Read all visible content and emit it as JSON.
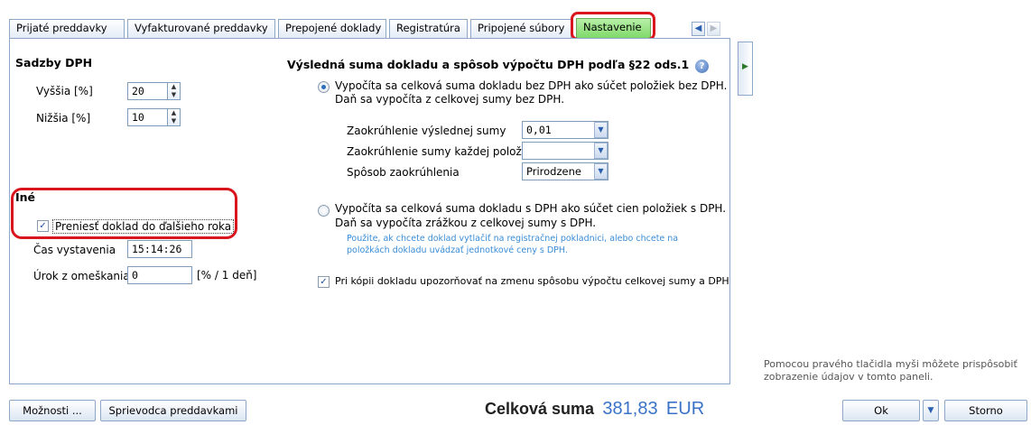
{
  "tabs": [
    {
      "label": "Prijaté preddavky"
    },
    {
      "label": "Vyfakturované preddavky"
    },
    {
      "label": "Prepojené doklady"
    },
    {
      "label": "Registratúra"
    },
    {
      "label": "Pripojené súbory"
    },
    {
      "label": "Nastavenie",
      "active": true
    }
  ],
  "vat_rates": {
    "title": "Sadzby DPH",
    "higher_label": "Vyššia [%]",
    "higher_value": "20",
    "lower_label": "Nižšia [%]",
    "lower_value": "10"
  },
  "calc": {
    "title": "Výsledná suma dokladu a spôsob výpočtu DPH podľa §22 ods.1",
    "option1_line1": "Vypočíta sa celková suma dokladu bez DPH ako súčet položiek bez DPH.",
    "option1_line2": "Daň sa vypočíta z celkovej sumy bez DPH.",
    "round_total_label": "Zaokrúhlenie výslednej sumy",
    "round_total_value": "0,01",
    "round_item_label": "Zaokrúhlenie sumy každej položky",
    "round_item_value": "",
    "round_method_label": "Spôsob zaokrúhlenia",
    "round_method_value": "Prirodzene",
    "option2_line1": "Vypočíta sa celková suma dokladu s DPH ako súčet cien položiek s DPH.",
    "option2_line2": "Daň sa vypočíta zrážkou z celkovej sumy s DPH.",
    "note_line1": "Použite, ak chcete doklad vytlačiť na registračnej pokladnici, alebo chcete na",
    "note_line2": "položkách dokladu uvádzať jednotkové ceny s DPH.",
    "warn_label": "Pri kópii dokladu upozorňovať na zmenu spôsobu výpočtu celkovej sumy a DPH",
    "selected_option": 1
  },
  "other": {
    "title": "Iné",
    "transfer_label": "Preniesť doklad do ďalšieho roka",
    "transfer_checked": true,
    "time_label": "Čas vystavenia",
    "time_value": "15:14:26",
    "interest_label": "Úrok z omeškania",
    "interest_value": "0",
    "interest_unit": "[% / 1 deň]"
  },
  "side_help": {
    "line1": "Pomocou pravého tlačidla myši môžete prispôsobiť",
    "line2": "zobrazenie údajov v tomto paneli."
  },
  "footer": {
    "options_label": "Možnosti ...",
    "wizard_label": "Sprievodca preddavkami",
    "total_label": "Celková suma",
    "total_value": "381,83",
    "currency": "EUR",
    "ok_label": "Ok",
    "cancel_label": "Storno"
  },
  "colors": {
    "active_tab": "#7fd86a",
    "highlight": "#d9161e",
    "total_value": "#3a72c8",
    "note": "#3a8cd6"
  }
}
